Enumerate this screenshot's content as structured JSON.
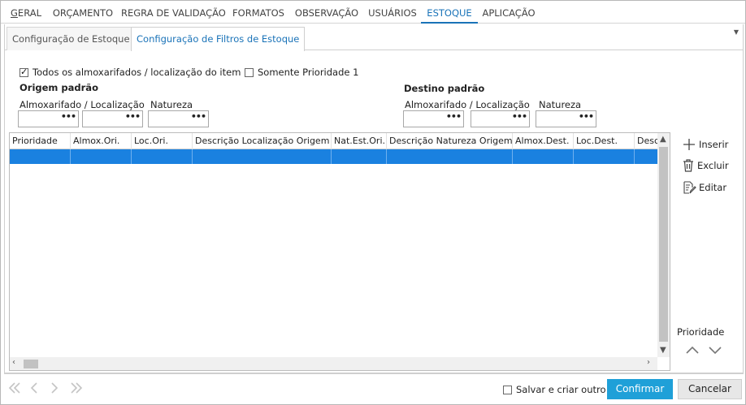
{
  "top_tabs": [
    {
      "label_pre": "",
      "label_ul": "G",
      "label_post": "ERAL",
      "active": false
    },
    {
      "label": "ORÇAMENTO",
      "active": false
    },
    {
      "label": "REGRA DE VALIDAÇÃO",
      "active": false
    },
    {
      "label": "FORMATOS",
      "active": false
    },
    {
      "label": "OBSERVAÇÃO",
      "active": false
    },
    {
      "label": "USUÁRIOS",
      "active": false
    },
    {
      "label": "ESTOQUE",
      "active": true
    },
    {
      "label": "APLICAÇÃO",
      "active": false
    }
  ],
  "sub_tabs": [
    {
      "label": "Configuração de Estoque",
      "active": false
    },
    {
      "label": "Configuração de Filtros de Estoque",
      "active": true
    }
  ],
  "filters": {
    "all_warehouses_label": "Todos os almoxarifados / localização do item",
    "all_warehouses_checked": true,
    "priority_one_label": "Somente Prioridade 1",
    "priority_one_checked": false
  },
  "origin": {
    "title": "Origem padrão",
    "warehouse_label": "Almoxarifado / Localização",
    "nature_label": "Natureza",
    "warehouse_value": "",
    "location_value": "",
    "nature_value": ""
  },
  "destination": {
    "title": "Destino padrão",
    "warehouse_label": "Almoxarifado / Localização",
    "nature_label": "Natureza",
    "warehouse_value": "",
    "location_value": "",
    "nature_value": ""
  },
  "lookup_glyph": "•••",
  "grid": {
    "columns": [
      "Prioridade",
      "Almox.Ori.",
      "Loc.Ori.",
      "Descrição Localização Origem",
      "Nat.Est.Ori.",
      "Descrição Natureza Origem",
      "Almox.Dest.",
      "Loc.Dest.",
      "Desc"
    ],
    "selection_color": "#1a81e0"
  },
  "side_actions": {
    "insert": "Inserir",
    "delete": "Excluir",
    "edit": "Editar",
    "priority_label": "Prioridade"
  },
  "footer": {
    "save_and_new_label": "Salvar e criar outro",
    "save_and_new_checked": false,
    "confirm_label": "Confirmar",
    "cancel_label": "Cancelar",
    "accent_color": "#1fa0d8"
  }
}
